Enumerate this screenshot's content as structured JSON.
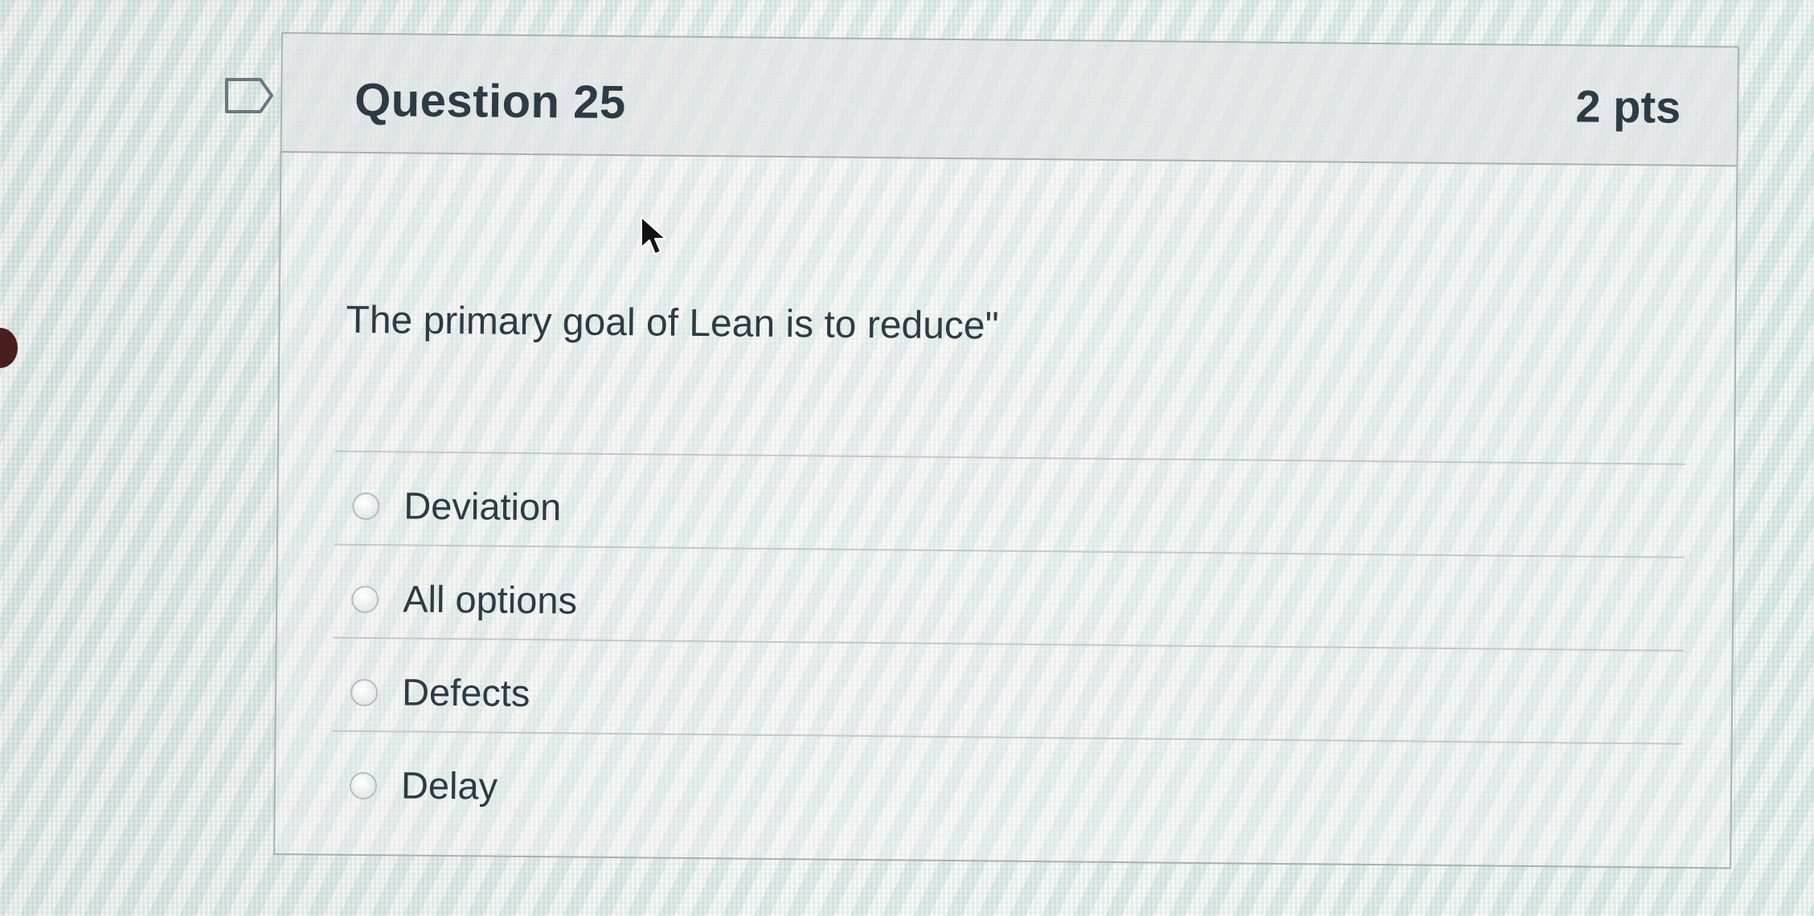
{
  "question": {
    "title": "Question 25",
    "points": "2 pts",
    "text": "The primary goal of Lean is to reduce\"",
    "flag_icon": "flag-icon",
    "answers": [
      {
        "label": "Deviation",
        "selected": false
      },
      {
        "label": "All options",
        "selected": false
      },
      {
        "label": "Defects",
        "selected": false
      },
      {
        "label": "Delay",
        "selected": false
      }
    ]
  },
  "colors": {
    "text": "#2d3b45",
    "border": "#a9b0b3",
    "header_bg": "#dce0e0"
  }
}
